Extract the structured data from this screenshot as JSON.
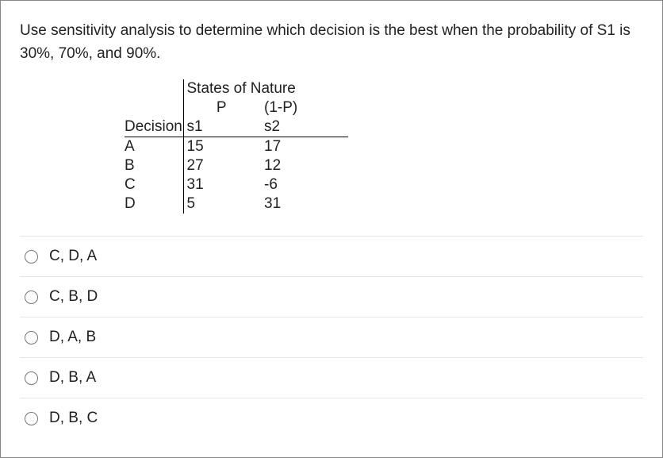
{
  "question": "Use sensitivity analysis to determine which decision is the best when the probability of S1 is 30%, 70%, and 90%.",
  "table": {
    "states_title": "States of Nature",
    "p_label": "P",
    "one_minus_p_label": "(1-P)",
    "decision_label": "Decision",
    "s1_label": "s1",
    "s2_label": "s2",
    "rows": [
      {
        "decision": "A",
        "s1": "15",
        "s2": "17"
      },
      {
        "decision": "B",
        "s1": "27",
        "s2": "12"
      },
      {
        "decision": "C",
        "s1": "31",
        "s2": "-6"
      },
      {
        "decision": "D",
        "s1": "5",
        "s2": "31"
      }
    ]
  },
  "options": [
    {
      "label": "C, D, A"
    },
    {
      "label": "C, B, D"
    },
    {
      "label": "D, A, B"
    },
    {
      "label": "D, B, A"
    },
    {
      "label": "D, B, C"
    }
  ]
}
